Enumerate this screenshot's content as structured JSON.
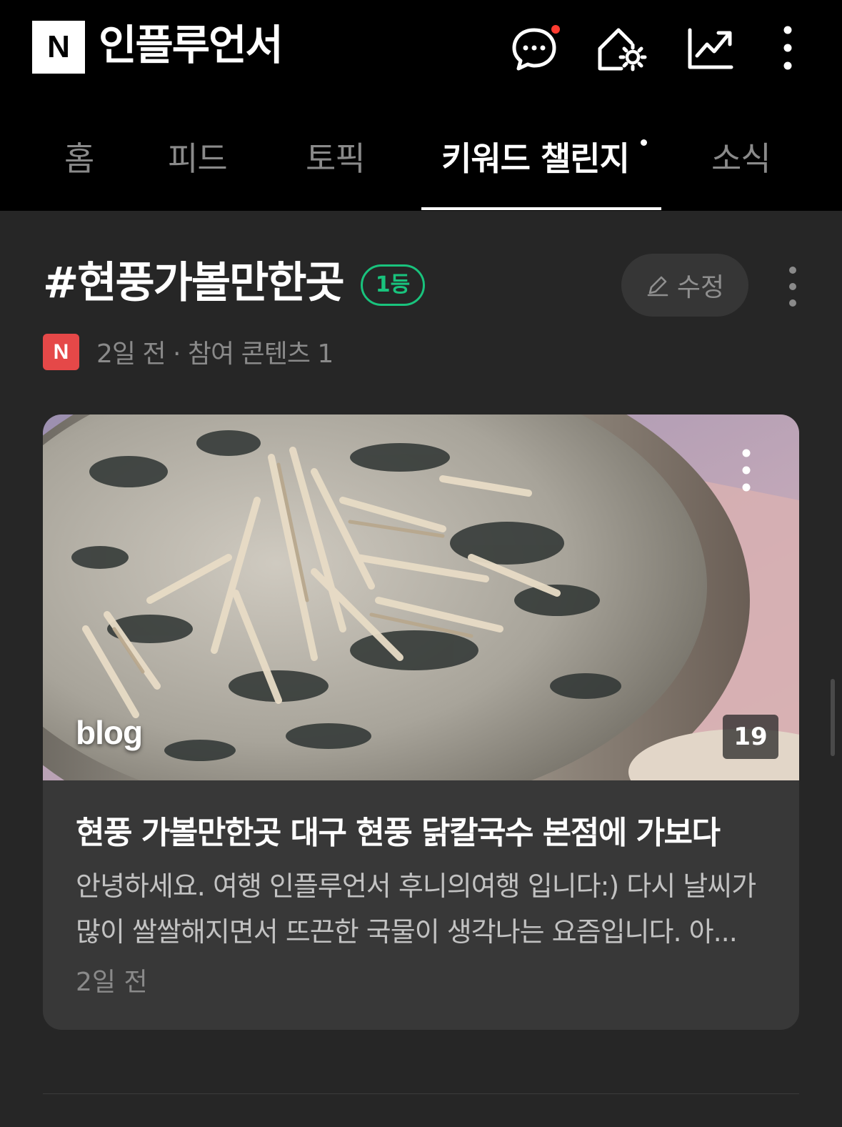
{
  "header": {
    "logo_letter": "N",
    "title": "인플루언서",
    "icons": [
      "chat-icon",
      "home-settings-icon",
      "trending-icon",
      "more-vertical-icon"
    ],
    "notification_color": "#ff3b30"
  },
  "tabs": [
    {
      "label": "홈",
      "active": false
    },
    {
      "label": "피드",
      "active": false
    },
    {
      "label": "토픽",
      "active": false
    },
    {
      "label": "키워드 챌린지",
      "active": true,
      "has_dot": true
    },
    {
      "label": "소식",
      "active": false
    }
  ],
  "keyword": {
    "title": "#현풍가볼만한곳",
    "rank": "1등",
    "rank_color": "#19c37d",
    "edit_label": "수정",
    "meta_logo": "N",
    "meta_logo_color": "#e54848",
    "meta_text": "2일 전 · 참여 콘텐츠 1"
  },
  "card": {
    "source_label": "blog",
    "image_count": "19",
    "title": "현풍 가볼만한곳 대구 현풍 닭칼국수 본점에 가보다",
    "description": "안녕하세요. 여행 인플루언서 후니의여행 입니다:) 다시 날씨가 많이 쌀쌀해지면서 뜨끈한 국물이 생각나는 요즘입니다. 아...",
    "time": "2일 전"
  },
  "colors": {
    "background": "#262626",
    "header_bg": "#000000",
    "card_bg": "#383838"
  }
}
